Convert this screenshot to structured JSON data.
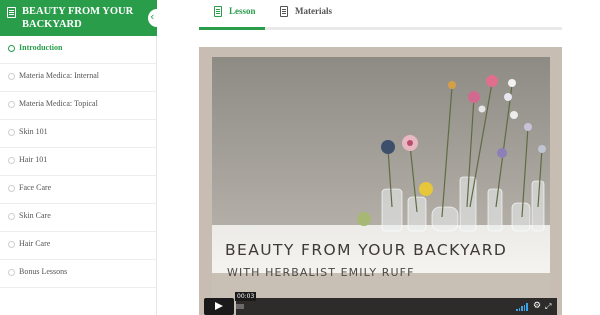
{
  "course": {
    "title": "BEAUTY FROM YOUR BACKYARD",
    "accent_color": "#2a9d4b"
  },
  "sidebar": {
    "collapse_icon": "chevron-left-icon",
    "lessons": [
      {
        "label": "Introduction",
        "active": true
      },
      {
        "label": "Materia Medica: Internal",
        "active": false
      },
      {
        "label": "Materia Medica: Topical",
        "active": false
      },
      {
        "label": "Skin 101",
        "active": false
      },
      {
        "label": "Hair 101",
        "active": false
      },
      {
        "label": "Face Care",
        "active": false
      },
      {
        "label": "Skin Care",
        "active": false
      },
      {
        "label": "Hair Care",
        "active": false
      },
      {
        "label": "Bonus Lessons",
        "active": false
      }
    ]
  },
  "tabs": {
    "lesson": {
      "label": "Lesson",
      "icon": "document-icon",
      "active": true
    },
    "materials": {
      "label": "Materials",
      "icon": "notebook-icon",
      "active": false
    }
  },
  "video": {
    "title": "BEAUTY FROM YOUR BACKYARD",
    "subtitle": "WITH HERBALIST EMILY RUFF",
    "current_time": "00:03",
    "volume_color": "#3ea3e6"
  }
}
